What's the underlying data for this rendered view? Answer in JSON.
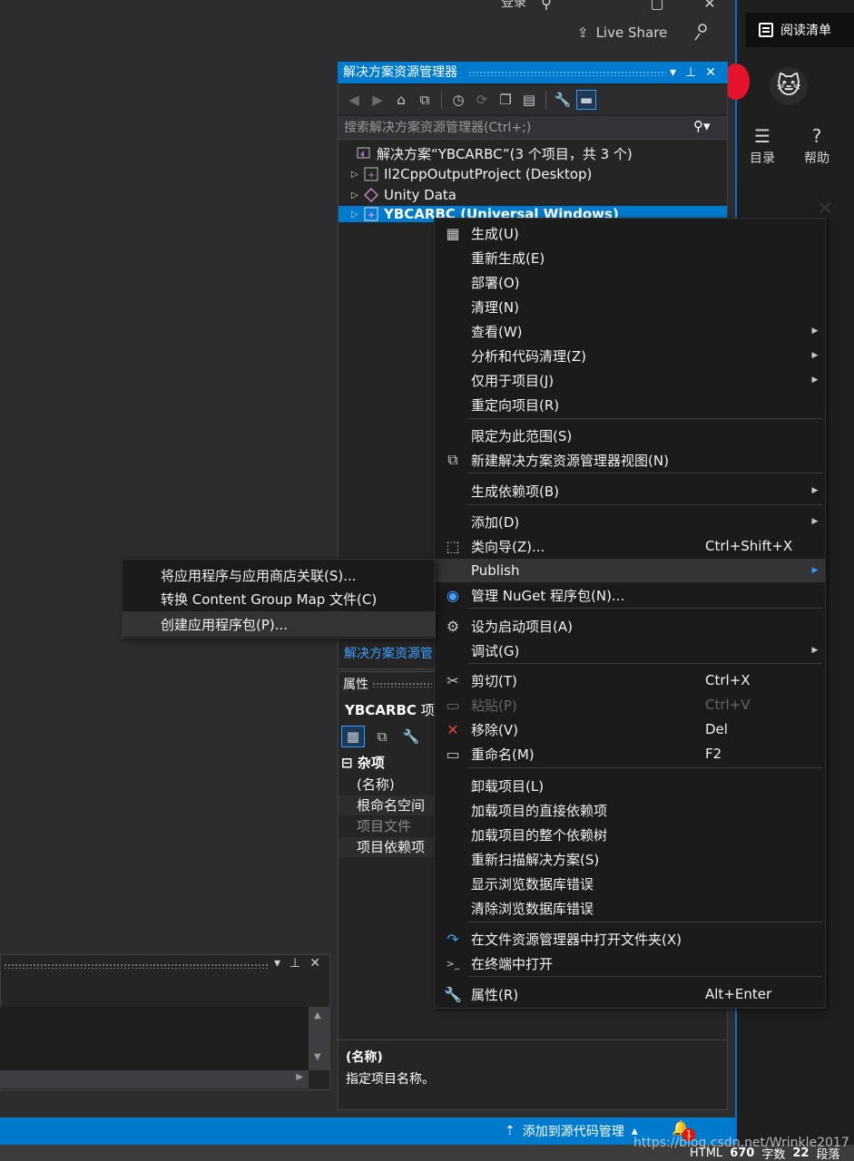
{
  "topbar": {
    "login_fragment": "登录",
    "live_share": "Live Share"
  },
  "browser": {
    "read_list": "阅读清单",
    "toc": "目录",
    "help": "帮助"
  },
  "solution_explorer": {
    "title": "解决方案资源管理器",
    "search_placeholder": "搜索解决方案资源管理器(Ctrl+;)",
    "solution_label": "解决方案“YBCARBC”(3 个项目，共 3 个)",
    "items": [
      {
        "label": "Il2CppOutputProject (Desktop)"
      },
      {
        "label": "Unity Data"
      },
      {
        "label": "YBCARBC (Universal Windows)"
      }
    ],
    "bottom_tab": "解决方案资源管"
  },
  "properties": {
    "title": "属性",
    "subject": "YBCARBC",
    "subject_suffix": "项",
    "category": "杂项",
    "rows": [
      {
        "label": "(名称)"
      },
      {
        "label": "根命名空间"
      },
      {
        "label": "项目文件"
      },
      {
        "label": "项目依赖项"
      }
    ],
    "desc_title": "(名称)",
    "desc_text": "指定项目名称。"
  },
  "context_menu": {
    "items": [
      {
        "label": "生成(U)",
        "shortcut": "",
        "icon": "build-icon"
      },
      {
        "label": "重新生成(E)",
        "shortcut": ""
      },
      {
        "label": "部署(O)",
        "shortcut": ""
      },
      {
        "label": "清理(N)",
        "shortcut": ""
      },
      {
        "label": "查看(W)",
        "shortcut": "",
        "submenu": true
      },
      {
        "label": "分析和代码清理(Z)",
        "shortcut": "",
        "submenu": true
      },
      {
        "label": "仅用于项目(J)",
        "shortcut": "",
        "submenu": true
      },
      {
        "label": "重定向项目(R)",
        "shortcut": ""
      },
      {
        "label": "限定为此范围(S)",
        "shortcut": ""
      },
      {
        "label": "新建解决方案资源管理器视图(N)",
        "shortcut": "",
        "icon": "new-view-icon"
      },
      {
        "label": "生成依赖项(B)",
        "shortcut": "",
        "submenu": true
      },
      {
        "label": "添加(D)",
        "shortcut": "",
        "submenu": true
      },
      {
        "label": "类向导(Z)...",
        "shortcut": "Ctrl+Shift+X",
        "icon": "class-wizard-icon"
      },
      {
        "label": "Publish",
        "shortcut": "",
        "submenu": true
      },
      {
        "label": "管理 NuGet 程序包(N)...",
        "shortcut": "",
        "icon": "nuget-icon"
      },
      {
        "label": "设为启动项目(A)",
        "shortcut": "",
        "icon": "gear-icon"
      },
      {
        "label": "调试(G)",
        "shortcut": "",
        "submenu": true
      },
      {
        "label": "剪切(T)",
        "shortcut": "Ctrl+X",
        "icon": "scissors-icon"
      },
      {
        "label": "粘贴(P)",
        "shortcut": "Ctrl+V",
        "icon": "paste-icon"
      },
      {
        "label": "移除(V)",
        "shortcut": "Del",
        "icon": "remove-icon"
      },
      {
        "label": "重命名(M)",
        "shortcut": "F2",
        "icon": "rename-icon"
      },
      {
        "label": "卸载项目(L)",
        "shortcut": ""
      },
      {
        "label": "加载项目的直接依赖项",
        "shortcut": ""
      },
      {
        "label": "加载项目的整个依赖树",
        "shortcut": ""
      },
      {
        "label": "重新扫描解决方案(S)",
        "shortcut": ""
      },
      {
        "label": "显示浏览数据库错误",
        "shortcut": ""
      },
      {
        "label": "清除浏览数据库错误",
        "shortcut": ""
      },
      {
        "label": "在文件资源管理器中打开文件夹(X)",
        "shortcut": "",
        "icon": "open-folder-icon"
      },
      {
        "label": "在终端中打开",
        "shortcut": "",
        "icon": "terminal-icon"
      },
      {
        "label": "属性(R)",
        "shortcut": "Alt+Enter",
        "icon": "wrench-icon"
      }
    ]
  },
  "publish_submenu": {
    "items": [
      {
        "label": "将应用程序与应用商店关联(S)..."
      },
      {
        "label": "转换 Content Group Map 文件(C)"
      },
      {
        "label": "创建应用程序包(P)..."
      }
    ]
  },
  "statusbar": {
    "source_control": "添加到源代码管理",
    "notification_count": "1",
    "watermark": "https://blog.csdn.net/Wrinkle2017"
  },
  "editor_status": {
    "mode": "HTML",
    "word_count": "670",
    "word_unit": "字数",
    "paragraph_count": "22",
    "paragraph_unit": "段落"
  }
}
